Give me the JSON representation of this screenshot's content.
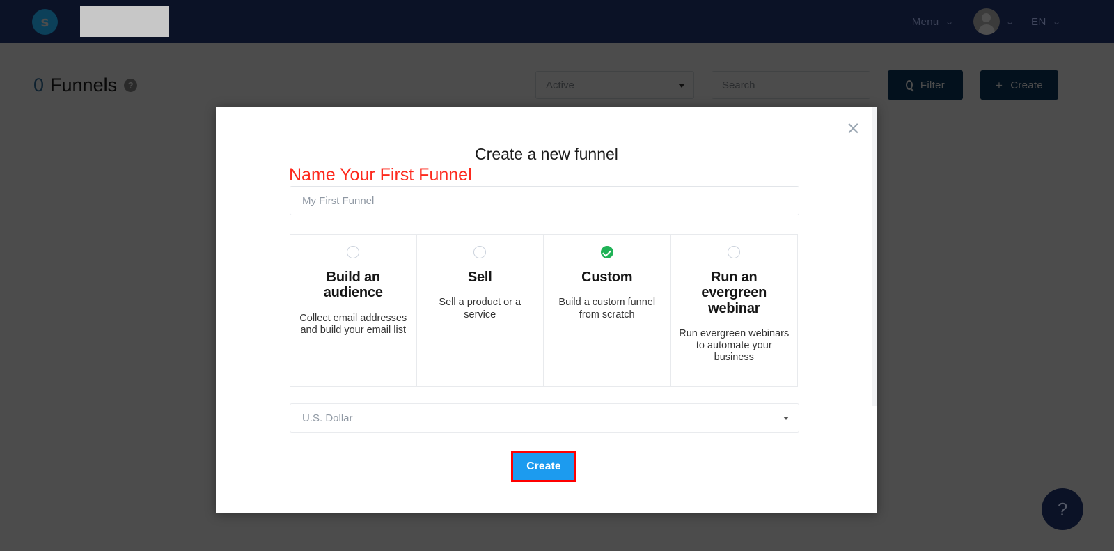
{
  "topbar": {
    "logo_letter": "s",
    "brand_redacted": "",
    "menu_label": "Menu",
    "menu_caret": "⌄",
    "avatar_caret": "⌄",
    "language_label": "EN",
    "language_caret": "⌄",
    "background_color": "#0b1226"
  },
  "page": {
    "count": "0",
    "title": "Funnels",
    "help_icon_label": "?",
    "status_filter": {
      "value": "Active"
    },
    "search": {
      "placeholder": "Search",
      "value": ""
    },
    "filter_button": "Filter",
    "create_button": "Create",
    "create_plus": "+"
  },
  "modal": {
    "close_label": "×",
    "title": "Create a new funnel",
    "subtitle": "Name Your First Funnel",
    "subtitle_color": "#fd2a1e",
    "funnel_name": {
      "placeholder": "My First Funnel",
      "value": ""
    },
    "options": [
      {
        "title": "Build an audience",
        "description": "Collect email addresses and build your email list",
        "selected": false
      },
      {
        "title": "Sell",
        "description": "Sell a product or a service",
        "selected": false
      },
      {
        "title": "Custom",
        "description": "Build a custom funnel from scratch",
        "selected": true
      },
      {
        "title": "Run an evergreen webinar",
        "description": "Run evergreen webinars to automate your business",
        "selected": false
      }
    ],
    "selected_color": "#20b256",
    "currency": {
      "value": "U.S. Dollar"
    },
    "submit_button": "Create",
    "submit_color": "#1c9bef",
    "highlight_color": "#ff0000"
  },
  "fab": {
    "label": "?"
  }
}
